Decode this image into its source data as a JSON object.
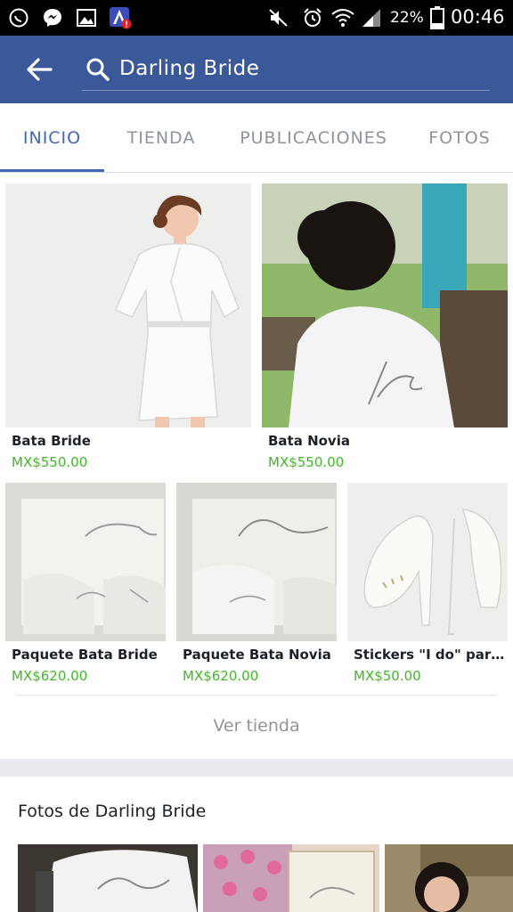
{
  "status_bar": {
    "battery": "22%",
    "time": "00:46",
    "icons": [
      "whatsapp-icon",
      "messenger-icon",
      "gallery-icon",
      "app-alert-icon",
      "mute-icon",
      "alarm-icon",
      "wifi-icon",
      "signal-icon",
      "battery-icon"
    ]
  },
  "header": {
    "search_query": "Darling Bride",
    "background": "#3b5998"
  },
  "tabs": [
    {
      "label": "INICIO",
      "active": true
    },
    {
      "label": "TIENDA",
      "active": false
    },
    {
      "label": "PUBLICACIONES",
      "active": false
    },
    {
      "label": "FOTOS",
      "active": false
    }
  ],
  "products": [
    {
      "name": "Bata Bride",
      "price": "MX$550.00"
    },
    {
      "name": "Bata Novia",
      "price": "MX$550.00"
    },
    {
      "name": "Paquete Bata Bride",
      "price": "MX$620.00"
    },
    {
      "name": "Paquete Bata Novia",
      "price": "MX$620.00"
    },
    {
      "name": "Stickers \"I do\" para los zapatos",
      "price": "MX$50.00"
    }
  ],
  "shop_footer": {
    "ver_tienda": "Ver tienda"
  },
  "photos": {
    "title": "Fotos de Darling Bride"
  },
  "colors": {
    "accent": "#4267b2",
    "price": "#42b72a",
    "text": "#1d2129",
    "muted": "#8d949e"
  }
}
